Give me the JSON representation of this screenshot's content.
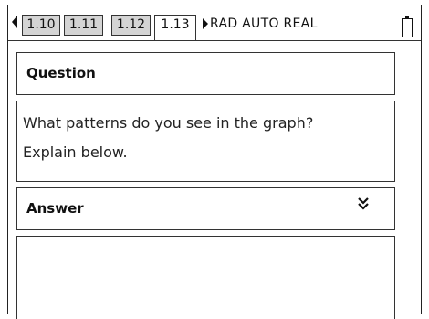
{
  "toolbar": {
    "tabs": [
      {
        "label": "1.10",
        "active": false
      },
      {
        "label": "1.11",
        "active": false
      },
      {
        "label": "1.12",
        "active": false
      },
      {
        "label": "1.13",
        "active": true
      }
    ],
    "mode_text": "RAD AUTO REAL",
    "left_arrow_icon": "left-arrow-icon",
    "battery_icon": "battery-icon"
  },
  "question": {
    "heading": "Question",
    "line1": "What patterns do you see in the graph?",
    "line2": "Explain below."
  },
  "answer": {
    "heading": "Answer",
    "collapse_icon": "double-chevron-down-icon",
    "value": ""
  }
}
